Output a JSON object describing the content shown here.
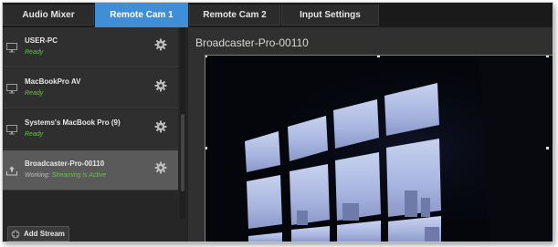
{
  "tabs": [
    {
      "label": "Audio Mixer",
      "active": false
    },
    {
      "label": "Remote Cam 1",
      "active": true
    },
    {
      "label": "Remote Cam 2",
      "active": false
    },
    {
      "label": "Input Settings",
      "active": false
    }
  ],
  "streams": [
    {
      "name": "USER-PC",
      "status": "Ready",
      "icon": "monitor-icon",
      "selected": false
    },
    {
      "name": "MacBookPro AV",
      "status": "Ready",
      "icon": "monitor-icon",
      "selected": false
    },
    {
      "name": "Systems's MacBook Pro (9)",
      "status": "Ready",
      "icon": "monitor-icon",
      "selected": false
    },
    {
      "name": "Broadcaster-Pro-00110",
      "status_label": "Working:",
      "status": "Streaming is Active",
      "icon": "upload-icon",
      "selected": true
    }
  ],
  "add_stream": {
    "label": "Add Stream",
    "icon": "plus-icon"
  },
  "preview": {
    "title": "Broadcaster-Pro-00110"
  },
  "colors": {
    "accent": "#3f8fd8",
    "ready": "#6cc04a",
    "selected_row": "#5a5a5a"
  }
}
